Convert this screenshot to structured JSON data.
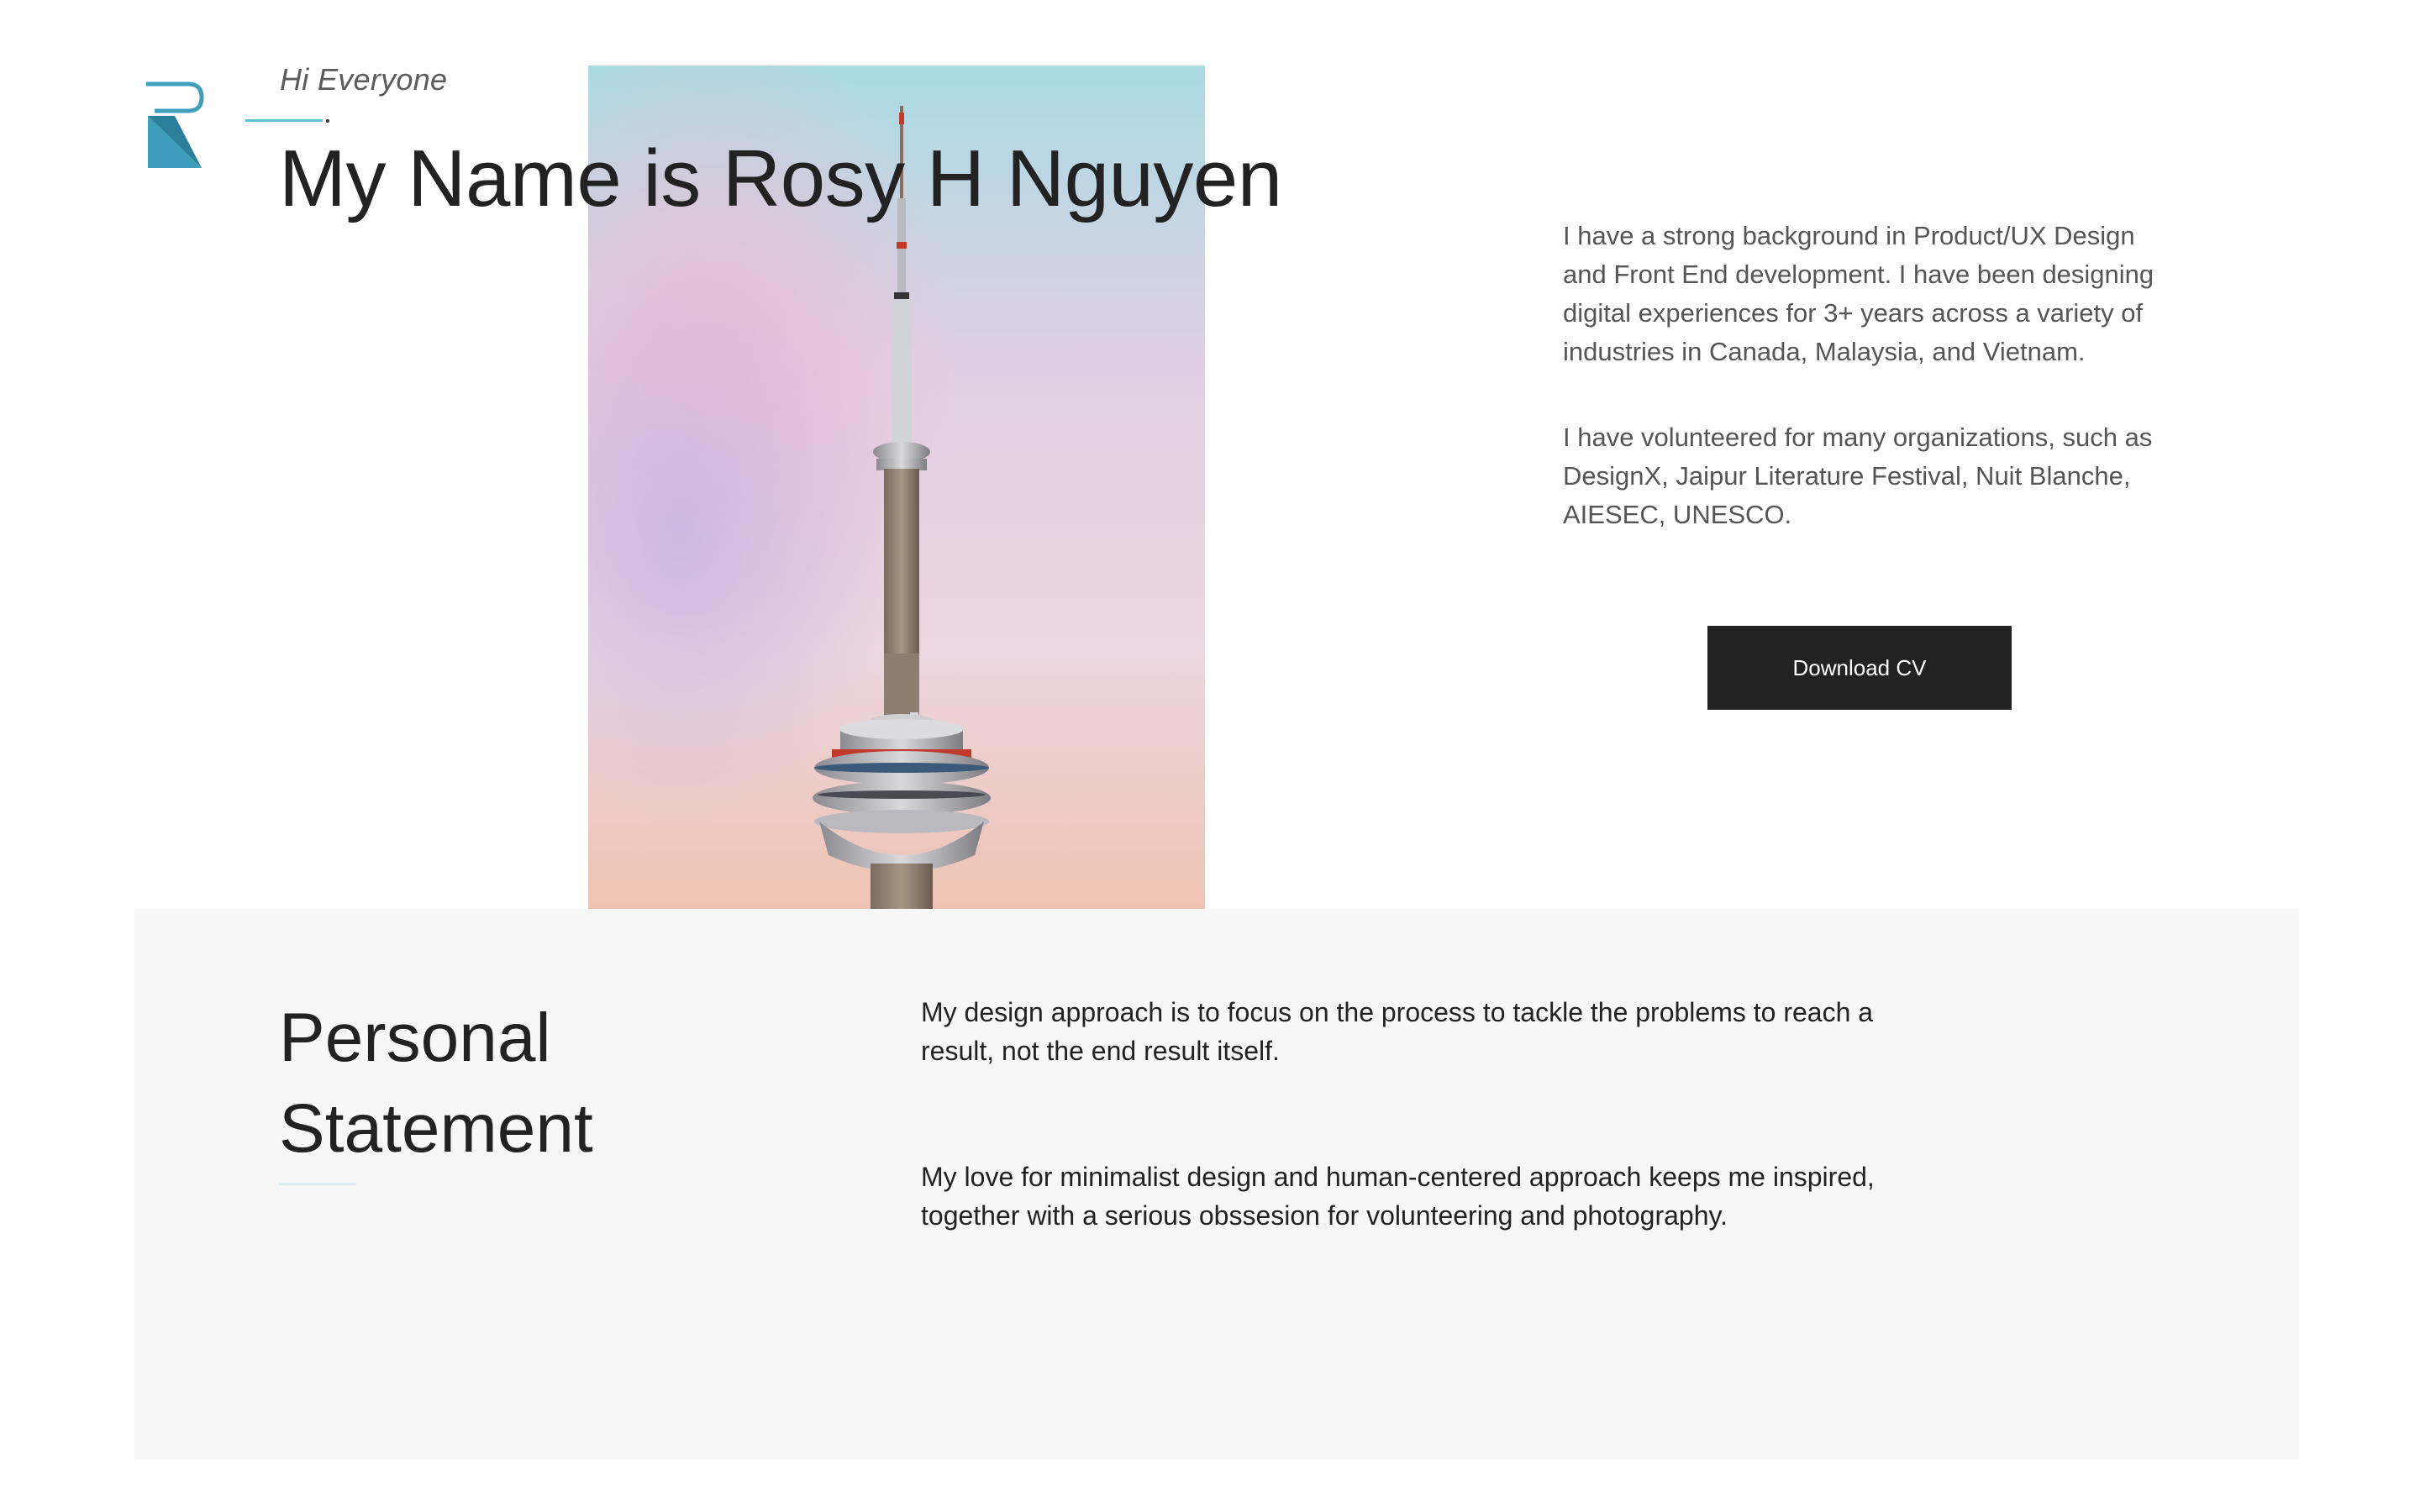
{
  "header": {
    "logo_icon": "rh-monogram-logo",
    "greeting": "Hi Everyone",
    "title": "My Name is Rosy H Nguyen"
  },
  "hero_image": {
    "subject": "tower-photo",
    "colors": {
      "sky_top": "#a9dbe3",
      "sky_mid": "#e6cde2",
      "sky_bottom": "#efc3b2"
    }
  },
  "about": {
    "paragraphs": [
      "I have a strong background in Product/UX Design and Front End development. I have been designing digital experiences for 3+ years across a variety of industries in Canada, Malaysia, and Vietnam.",
      "I have volunteered for many organizations, such as DesignX, Jaipur Literature Festival, Nuit Blanche, AIESEC, UNESCO."
    ],
    "download_label": "Download CV"
  },
  "statement": {
    "title": "Personal Statement",
    "paragraphs": [
      "My design approach is to focus on the process to tackle the problems to reach a result, not the end result itself.",
      "My love for minimalist design and human-centered approach keeps me inspired, together with a serious obssesion for volunteering and photography."
    ]
  },
  "colors": {
    "accent": "#5fc0cf",
    "logo_teal": "#3d9fbc",
    "button_bg": "#222222",
    "statement_bg": "#f7f7f7"
  }
}
